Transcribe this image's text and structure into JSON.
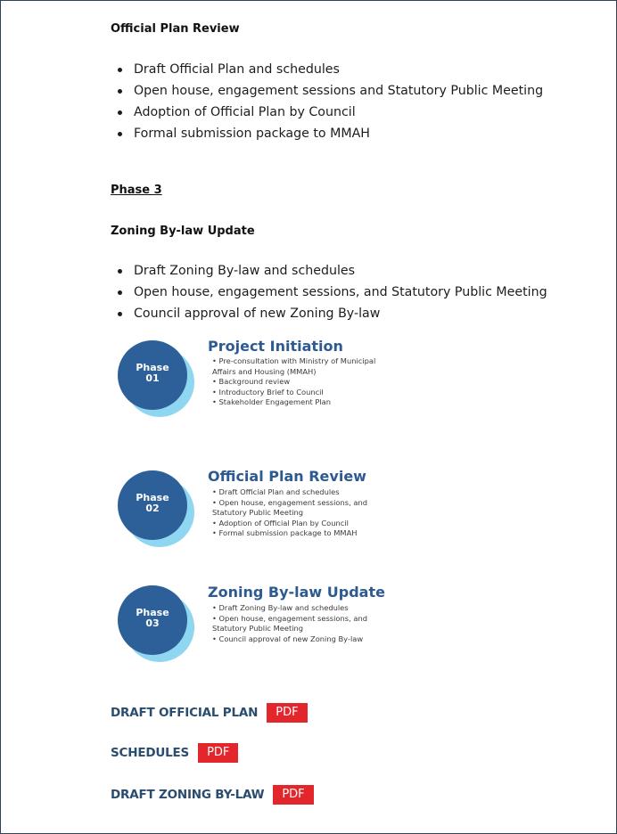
{
  "sections": {
    "official_plan_review": {
      "heading": "Official Plan Review",
      "items": [
        "Draft Official Plan and schedules",
        "Open house, engagement sessions and Statutory Public Meeting",
        "Adoption of Official Plan by Council",
        "Formal submission package to MMAH"
      ]
    },
    "phase3": {
      "phase_heading": "Phase 3",
      "heading": "Zoning By-law Update",
      "items": [
        "Draft Zoning By-law and schedules",
        "Open house, engagement sessions, and Statutory Public Meeting",
        "Council approval of new Zoning By-law"
      ]
    }
  },
  "infographic": {
    "phases": [
      {
        "label": "Phase",
        "number": "01",
        "title": "Project Initiation",
        "items": [
          "• Pre-consultation with Ministry of Municipal",
          "  Affairs and Housing (MMAH)",
          "• Background review",
          "• Introductory Brief to Council",
          "• Stakeholder Engagement Plan"
        ]
      },
      {
        "label": "Phase",
        "number": "02",
        "title": "Official Plan Review",
        "items": [
          "• Draft Official Plan and schedules",
          "• Open house, engagement sessions, and",
          "  Statutory Public Meeting",
          "• Adoption of Official Plan by Council",
          "• Formal submission package to MMAH"
        ]
      },
      {
        "label": "Phase",
        "number": "03",
        "title": "Zoning By-law Update",
        "items": [
          "• Draft Zoning By-law and schedules",
          "• Open house, engagement sessions, and",
          "  Statutory Public Meeting",
          "• Council approval of new Zoning By-law"
        ]
      }
    ]
  },
  "downloads": [
    {
      "label": "DRAFT OFFICIAL PLAN",
      "badge": "PDF"
    },
    {
      "label": "SCHEDULES",
      "badge": "PDF"
    },
    {
      "label": "DRAFT ZONING BY-LAW",
      "badge": "PDF"
    }
  ],
  "colors": {
    "disk": "#2d5f98",
    "disk_shadow": "#8fd6f1",
    "phase_title": "#2c5a91",
    "download_label": "#2a4c6e",
    "pdf_badge": "#e2262b",
    "frame_border": "#2f4258"
  }
}
